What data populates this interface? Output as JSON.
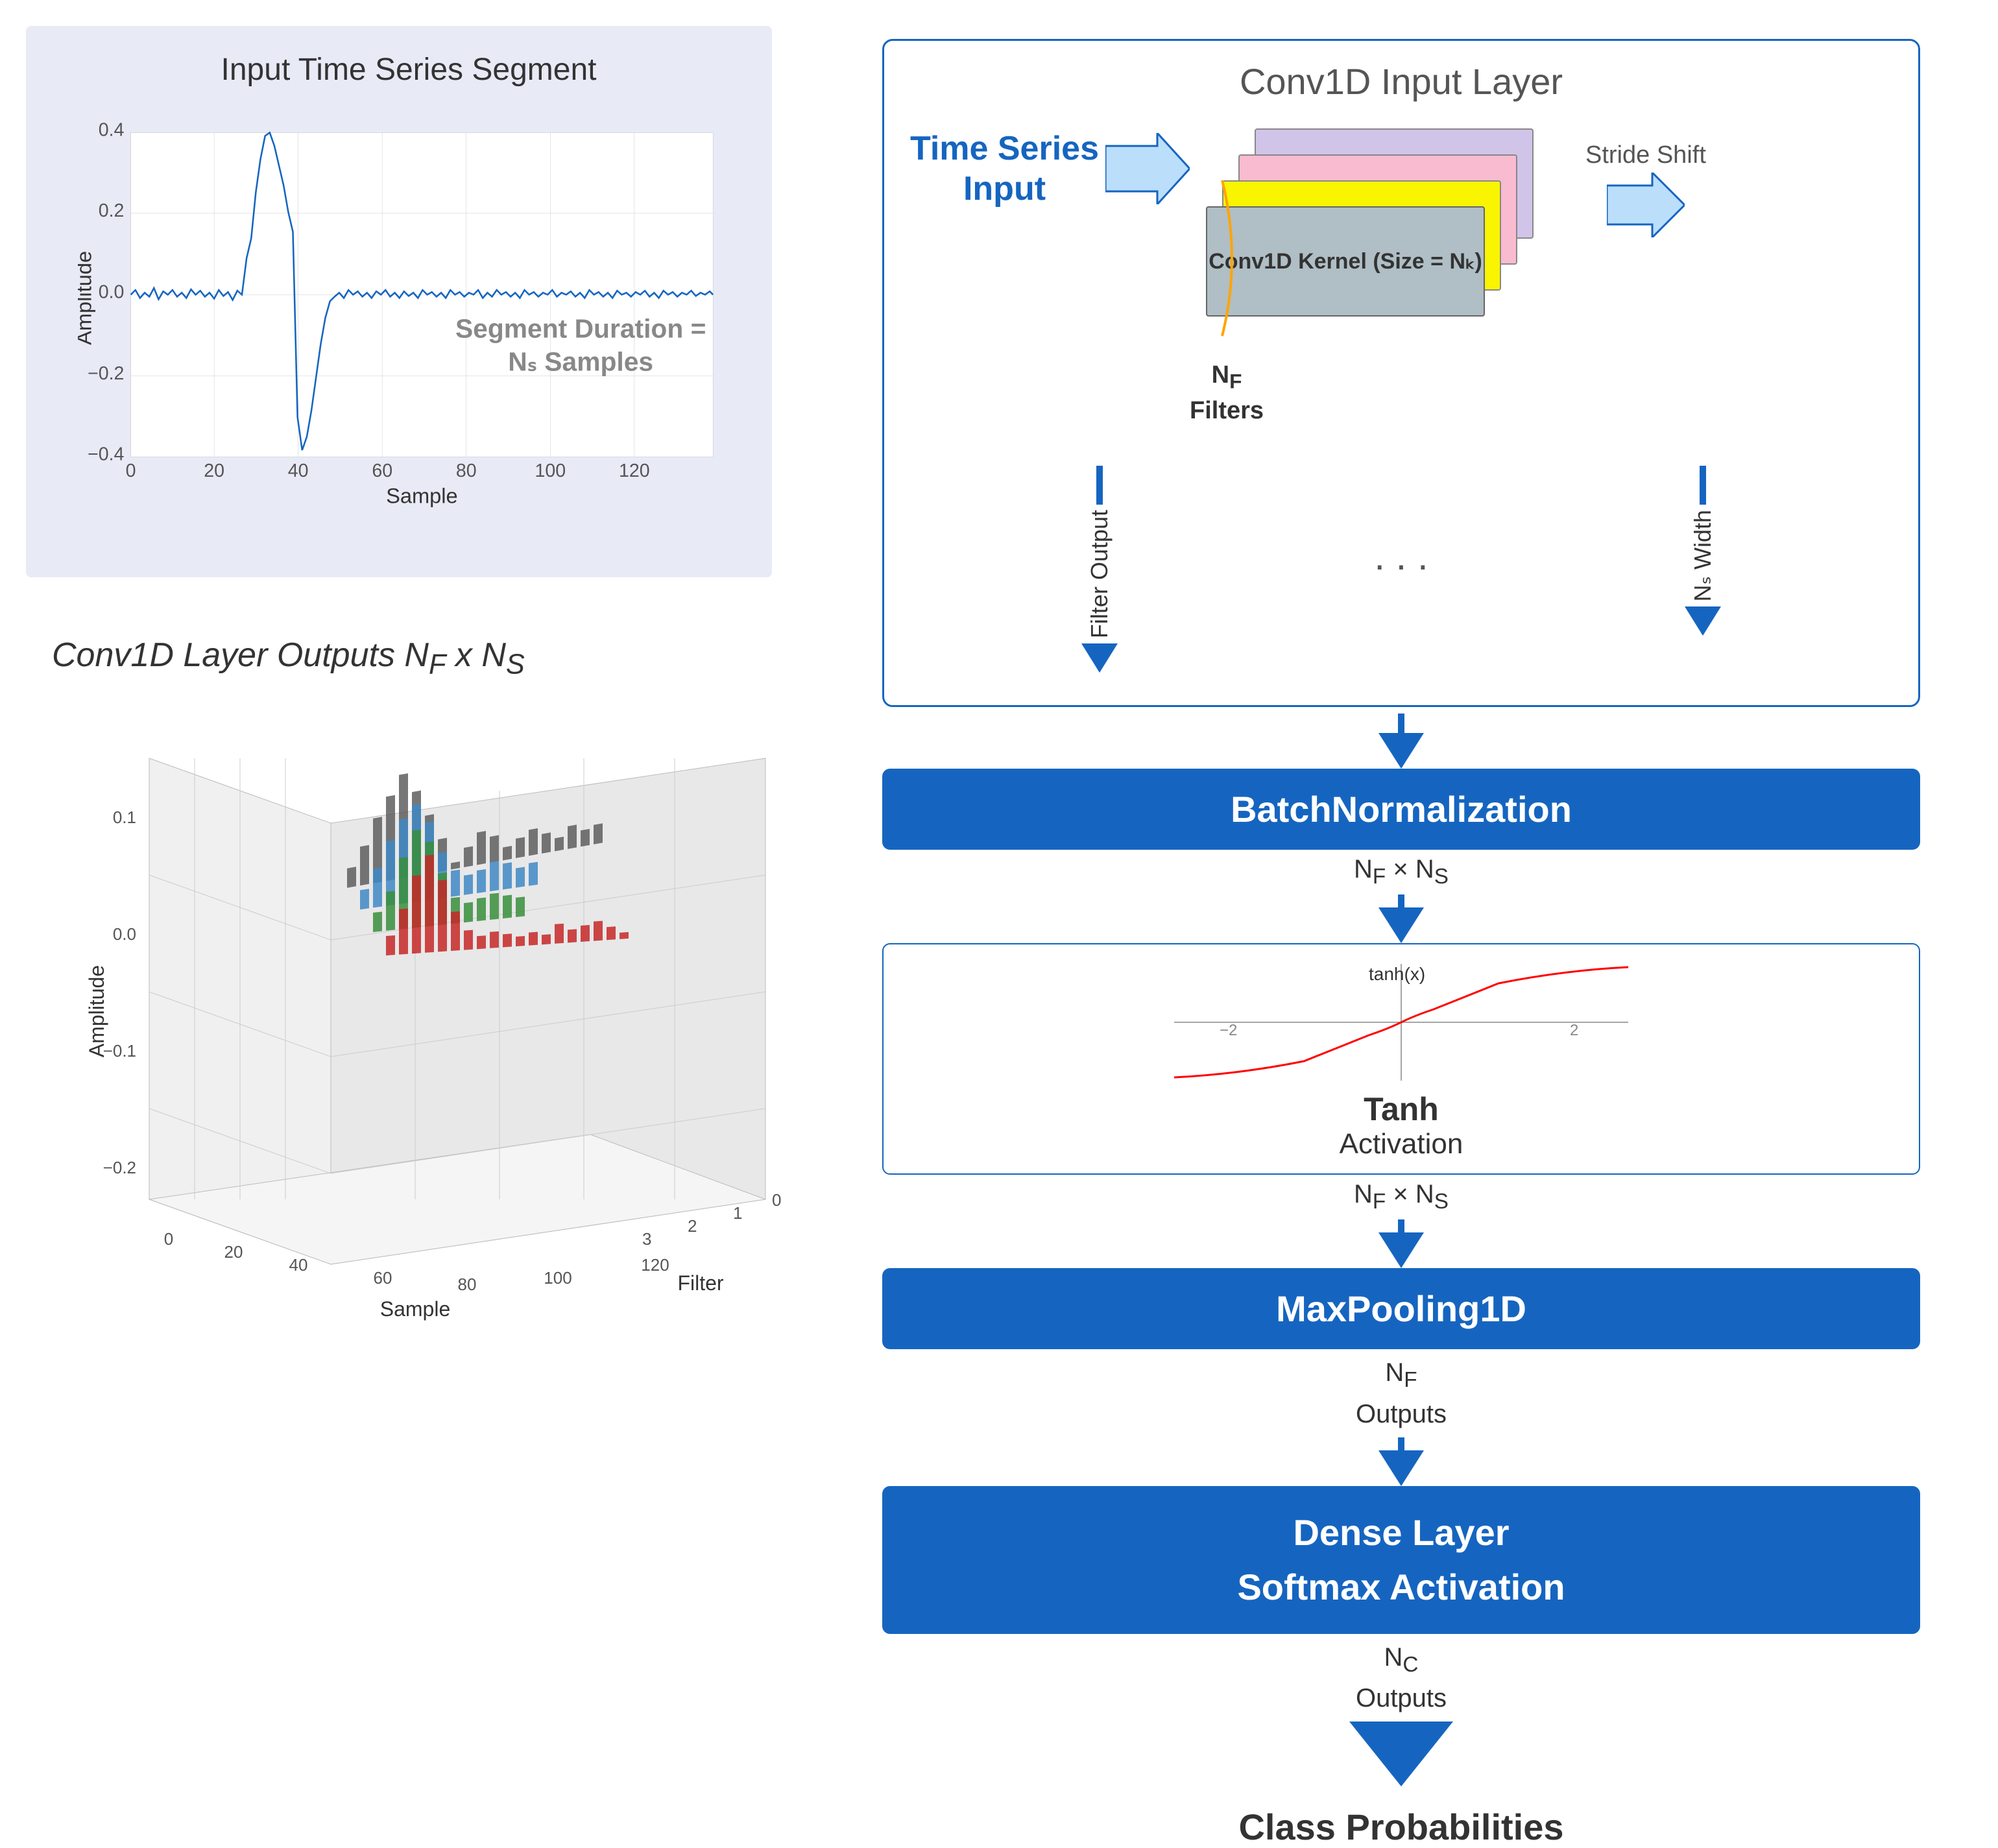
{
  "topChart": {
    "title": "Input Time Series Segment",
    "xLabel": "Sample",
    "yLabel": "Amplitude",
    "xTicks": [
      "0",
      "20",
      "40",
      "60",
      "80",
      "100",
      "120"
    ],
    "yTicks": [
      "-0.4",
      "-0.2",
      "0.0",
      "0.2",
      "0.4"
    ],
    "segmentLabel": "Segment Duration =\nNₛ Samples"
  },
  "bottomChart": {
    "title": "Conv1D Layer Outputs N",
    "titleSub": "F",
    "titleRest": " x N",
    "titleSub2": "S",
    "xLabel": "Sample",
    "yLabel": "Amplitude",
    "zLabel": "Filter",
    "xTicks": [
      "0",
      "20",
      "40",
      "60",
      "80",
      "100",
      "120"
    ],
    "yTicks": [
      "0.1",
      "0.0",
      "-0.1",
      "-0.2"
    ],
    "zTicks": [
      "0",
      "1",
      "2",
      "3"
    ]
  },
  "diagram": {
    "conv1dTitle": "Conv1D Input Layer",
    "timeSeriesLabel": "Time Series\nInput",
    "strideLabel": "Stride Shift",
    "kernelLabel": "Conv1D Kernel (Size = Nₖ)",
    "nfLabel": "N₁\nFilters",
    "filterOutputLabel": "Filter Output",
    "nsWidthLabel": "Nₛ Width",
    "dotsLabel": "...",
    "batchNormLabel": "BatchNormalization",
    "nfNsLabel1": "N₁ × Nₛ",
    "tanhTitle": "Tanh",
    "tanhSubtitle": "Activation",
    "nfNsLabel2": "N₁ × Nₛ",
    "maxPoolLabel": "MaxPooling1D",
    "nfOutputsLabel": "N₁\nOutputs",
    "denseLabel": "Dense Layer\nSoftmax Activation",
    "ncOutputsLabel": "N⁣\nOutputs",
    "classProbLabel": "Class Probabilities"
  }
}
